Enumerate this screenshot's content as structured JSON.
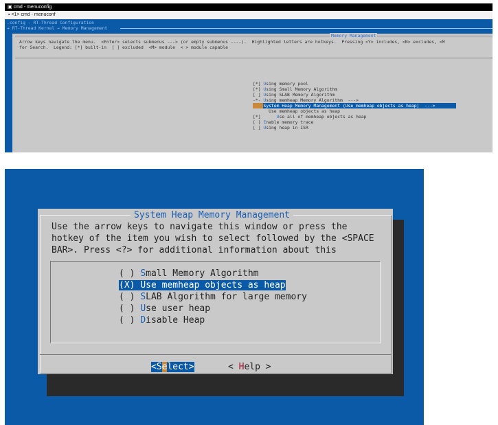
{
  "window": {
    "title": "cmd - menuconfig",
    "tab": "<1> cmd - menuconf"
  },
  "top": {
    "config_title": ".config - RT-Thread Configuration",
    "breadcrumb": "→ RT-Thread Kernel → Memory Management",
    "panel_title": "Memory Management",
    "help1": "Arrow keys navigate the menu.  <Enter> selects submenus ---> (or empty submenus ----).  Highlighted letters are hotkeys.  Pressing <Y> includes, <N> excludes, <M",
    "help2": "for Search.  Legend: [*] built-in  [ ] excluded  <M> module  < > module capable",
    "items": [
      {
        "prefix": "[*] ",
        "hot": "U",
        "rest": "sing memory pool"
      },
      {
        "prefix": "[*] ",
        "hot": "U",
        "rest": "sing Small Memory Algorithm"
      },
      {
        "prefix": "[ ] ",
        "hot": "U",
        "rest": "sing SLAB Memory Algorithm"
      },
      {
        "prefix": "-*- ",
        "hot": "U",
        "rest": "sing memheap Memory Algorithm  --->"
      },
      {
        "prefix": "    ",
        "hot": "",
        "rest": "System Heap Memory Management (Use memheap objects as heap)  --->",
        "selected": true
      },
      {
        "prefix": "      ",
        "hot": "",
        "rest": "Use memheap objects as heap"
      },
      {
        "prefix": "[*]      ",
        "hot": "U",
        "rest": "se all of memheap objects as heap"
      },
      {
        "prefix": "[ ] ",
        "hot": "E",
        "rest": "nable memory trace"
      },
      {
        "prefix": "[ ] ",
        "hot": "U",
        "rest": "sing heap in ISR"
      }
    ]
  },
  "dialog": {
    "title": "System Heap Memory Management",
    "help": [
      "Use the arrow keys to navigate this window or press the",
      "hotkey of the item you wish to select followed by the <SPACE",
      "BAR>. Press <?> for additional information about this"
    ],
    "options": [
      {
        "mark": "( ) ",
        "hot": "S",
        "rest": "mall Memory Algorithm"
      },
      {
        "mark": "(X) ",
        "hot": "U",
        "rest": "se memheap objects as heap",
        "selected": true
      },
      {
        "mark": "( ) ",
        "hot": "S",
        "rest": "LAB Algorithm for large memory"
      },
      {
        "mark": "( ) ",
        "hot": "U",
        "rest": "se user heap"
      },
      {
        "mark": "( ) ",
        "hot": "D",
        "rest": "isable Heap"
      }
    ],
    "select": {
      "a": "<S",
      "hot": "e",
      "b": "lect>"
    },
    "help_btn": {
      "a": "< ",
      "hot": "H",
      "b": "elp >"
    }
  },
  "colors": {
    "background": "#0a5aa8",
    "panel": "#c9c9c9",
    "hotkey": "#1a5fb4"
  }
}
